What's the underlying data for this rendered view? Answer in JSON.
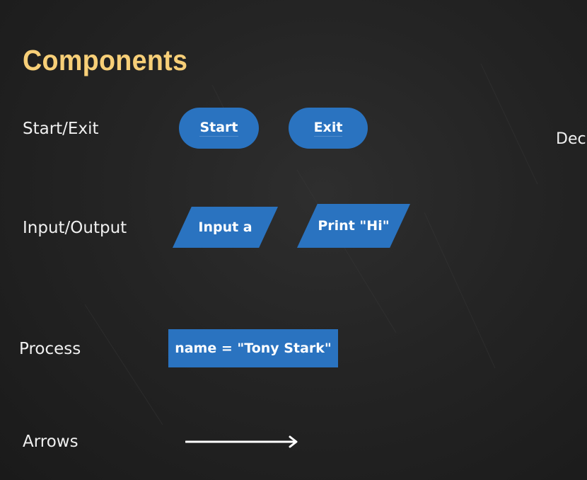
{
  "title": "Components",
  "rows": {
    "start_exit": {
      "label": "Start/Exit",
      "shapes": [
        "Start",
        "Exit"
      ]
    },
    "input_output": {
      "label": "Input/Output",
      "shapes": [
        "Input a",
        "Print \"Hi\""
      ]
    },
    "process": {
      "label": "Process",
      "shapes": [
        "name = \"Tony Stark\""
      ]
    },
    "arrows": {
      "label": "Arrows"
    }
  },
  "side_label": "Deci",
  "colors": {
    "title": "#f7cf78",
    "shape_fill": "#2a73c0",
    "background": "#242424",
    "text": "#f0f0f0"
  }
}
